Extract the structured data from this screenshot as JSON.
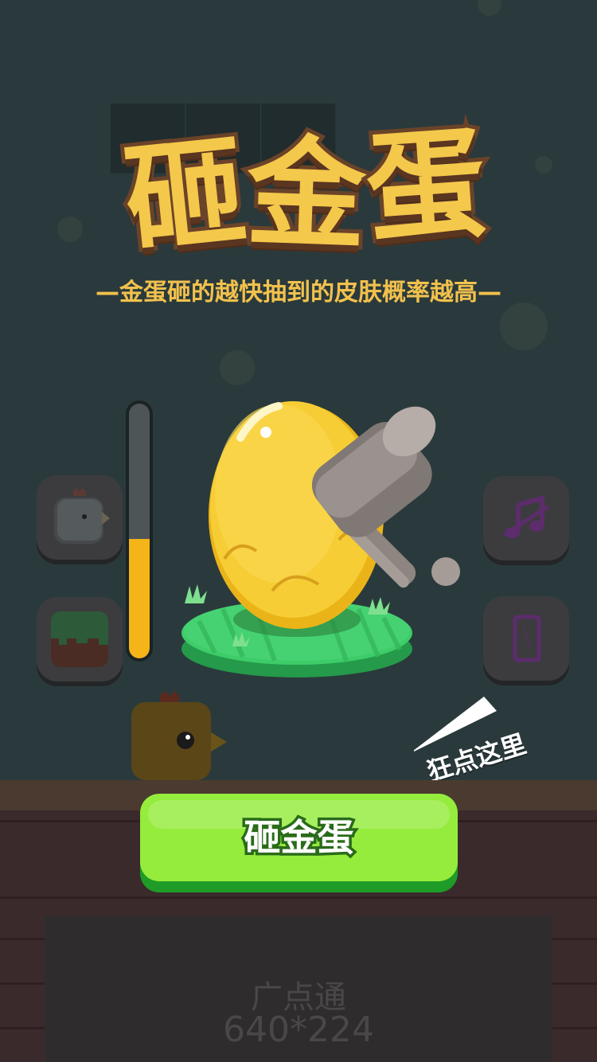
{
  "header": {
    "title_chars": [
      "砸",
      "金",
      "蛋"
    ],
    "subtitle": "—金蛋砸的越快抽到的皮肤概率越高—"
  },
  "power_meter": {
    "fill_fraction": 0.47,
    "fill_color": "#f5b417"
  },
  "side_buttons": {
    "top_left": {
      "icon": "chicken-skin-icon"
    },
    "bottom_left": {
      "icon": "grass-block-icon"
    },
    "top_right": {
      "icon": "music-note-icon"
    },
    "bottom_right": {
      "icon": "phone-vibrate-icon"
    }
  },
  "hint": {
    "text": "狂点这里"
  },
  "action_button": {
    "label": "砸金蛋",
    "color": "#95ec3c"
  },
  "ad": {
    "line1": "广点通",
    "line2": "640*224"
  },
  "colors": {
    "title": "#f4c84a",
    "title_outline": "#6b4329",
    "background": "#2a3a3c"
  }
}
